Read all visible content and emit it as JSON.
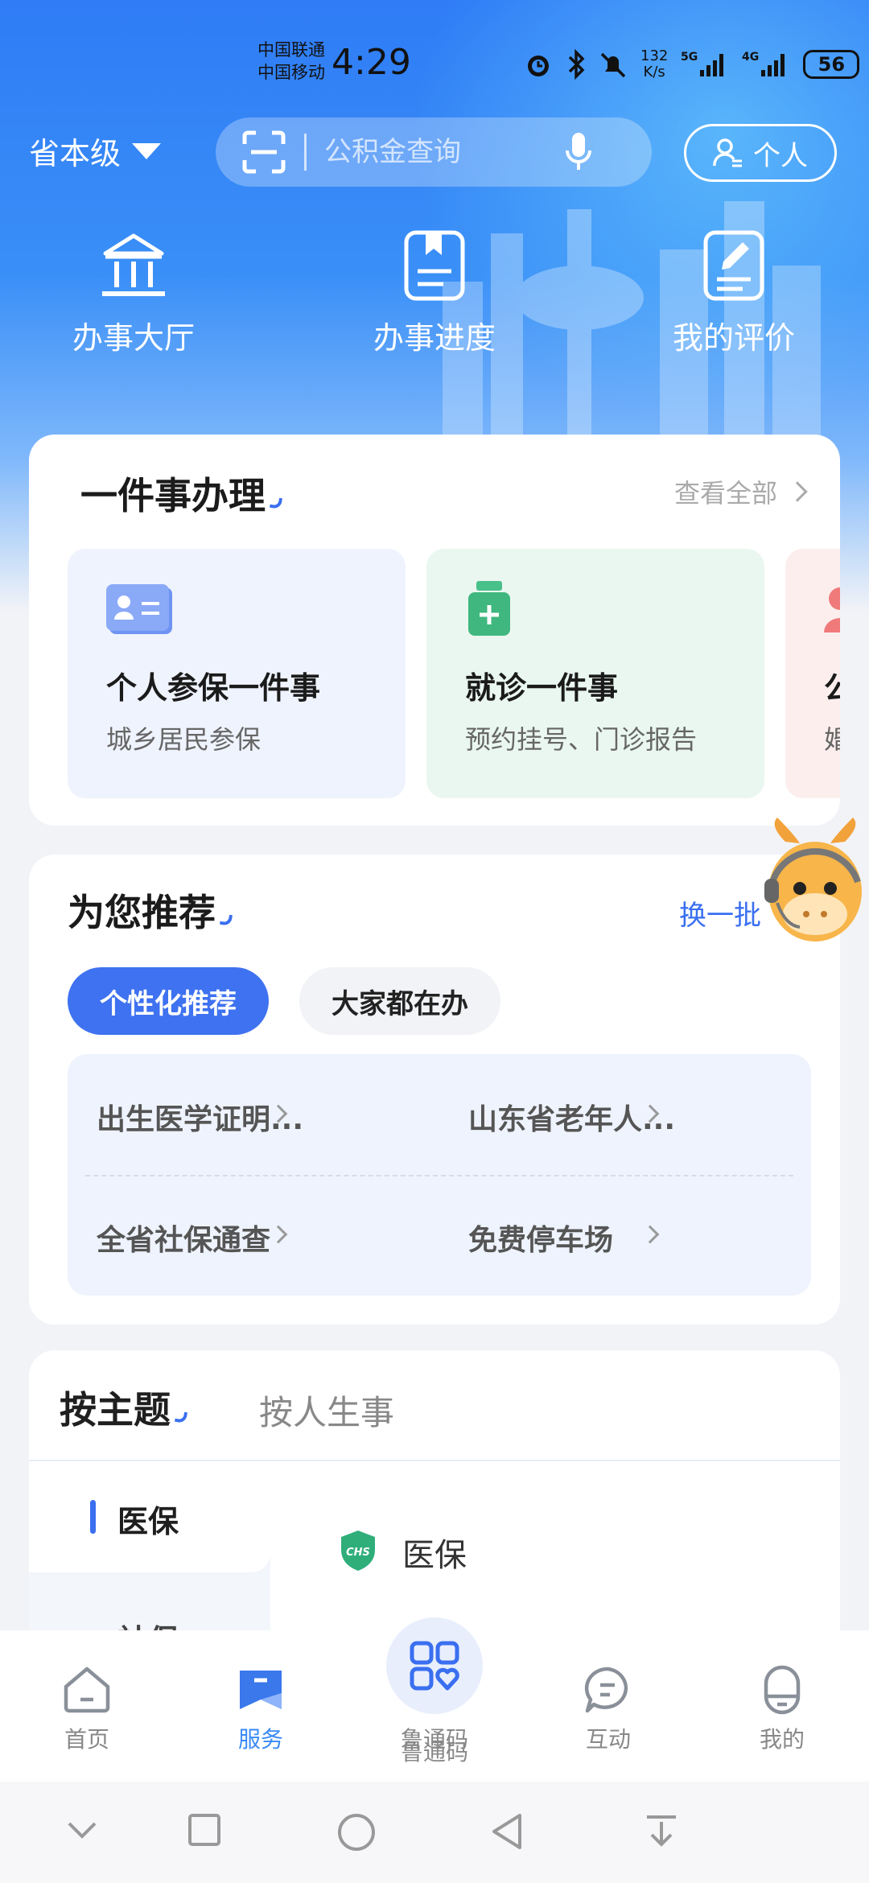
{
  "status_bar": {
    "carrier1": "中国联通",
    "carrier2": "中国移动",
    "time": "4:29",
    "net_speed_value": "132",
    "net_speed_unit": "K/s",
    "battery": "56"
  },
  "header": {
    "region": "省本级",
    "search_placeholder": "公积金查询",
    "personal_label": "个人"
  },
  "quick_entries": [
    {
      "label": "办事大厅",
      "icon": "government-building-icon"
    },
    {
      "label": "办事进度",
      "icon": "bookmark-document-icon"
    },
    {
      "label": "我的评价",
      "icon": "edit-document-icon"
    }
  ],
  "one_thing": {
    "title": "一件事办理",
    "view_all": "查看全部",
    "items": [
      {
        "title": "个人参保一件事",
        "subtitle": "城乡居民参保",
        "icon": "id-card-icon",
        "bg": "#eff3fd"
      },
      {
        "title": "就诊一件事",
        "subtitle": "预约挂号、门诊报告",
        "icon": "medicine-bottle-icon",
        "bg": "#eaf7f0"
      },
      {
        "title": "公",
        "subtitle": "婚",
        "icon": "person-icon",
        "bg": "#fdeeee"
      }
    ]
  },
  "recommend": {
    "title": "为您推荐",
    "refresh": "换一批",
    "tabs": [
      {
        "label": "个性化推荐",
        "active": true
      },
      {
        "label": "大家都在办",
        "active": false
      }
    ],
    "items": [
      "出生医学证明...",
      "山东省老年人...",
      "全省社保通查",
      "免费停车场"
    ]
  },
  "topics": {
    "tabs": [
      "按主题",
      "按人生事"
    ],
    "sidebar": [
      "医保",
      "社保"
    ],
    "content_title": "医保",
    "content_icon_text": "CHS"
  },
  "bottom_nav": {
    "items": [
      {
        "label": "首页",
        "icon": "home-icon",
        "active": false
      },
      {
        "label": "服务",
        "icon": "service-icon",
        "active": true
      },
      {
        "label": "鲁通码",
        "icon": "code-grid-icon",
        "active": false
      },
      {
        "label": "互动",
        "icon": "chat-bubble-icon",
        "active": false
      },
      {
        "label": "我的",
        "icon": "user-icon",
        "active": false
      }
    ]
  },
  "colors": {
    "accent": "#3a6ff0",
    "pill_active": "#3f72f0",
    "nav_active": "#3a8af4"
  }
}
